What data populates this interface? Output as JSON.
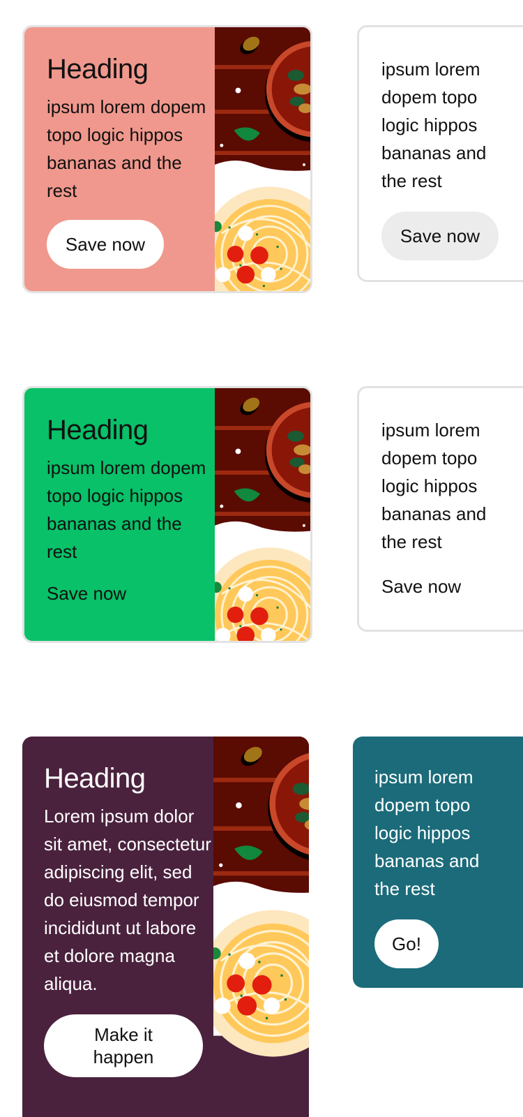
{
  "cards": [
    {
      "heading": "Heading",
      "text": "ipsum lorem dopem topo logic hippos bananas and the rest",
      "button": "Save now",
      "bg": "#f0988d",
      "image": "pasta-image"
    },
    {
      "text": "ipsum lorem dopem topo logic hippos bananas and the rest",
      "button": "Save now",
      "button_bg": "#ececec"
    },
    {
      "heading": "Heading",
      "text": "ipsum lorem dopem topo logic hippos bananas and the rest",
      "button": "Save now",
      "bg": "#08c168",
      "image": "pasta-image"
    },
    {
      "text": "ipsum lorem dopem topo logic hippos bananas and the rest",
      "button": "Save now"
    },
    {
      "heading": "Heading",
      "text": "Lorem ipsum dolor sit amet, consectetur adipiscing elit, sed do eiusmod tempor incididunt ut labore et dolore magna aliqua.",
      "button": "Make it happen",
      "bg": "#4a223d",
      "image": "pasta-image"
    },
    {
      "text": "ipsum lorem dopem topo logic hippos bananas and the rest",
      "button": "Go!",
      "bg": "#1b6b7a"
    }
  ]
}
